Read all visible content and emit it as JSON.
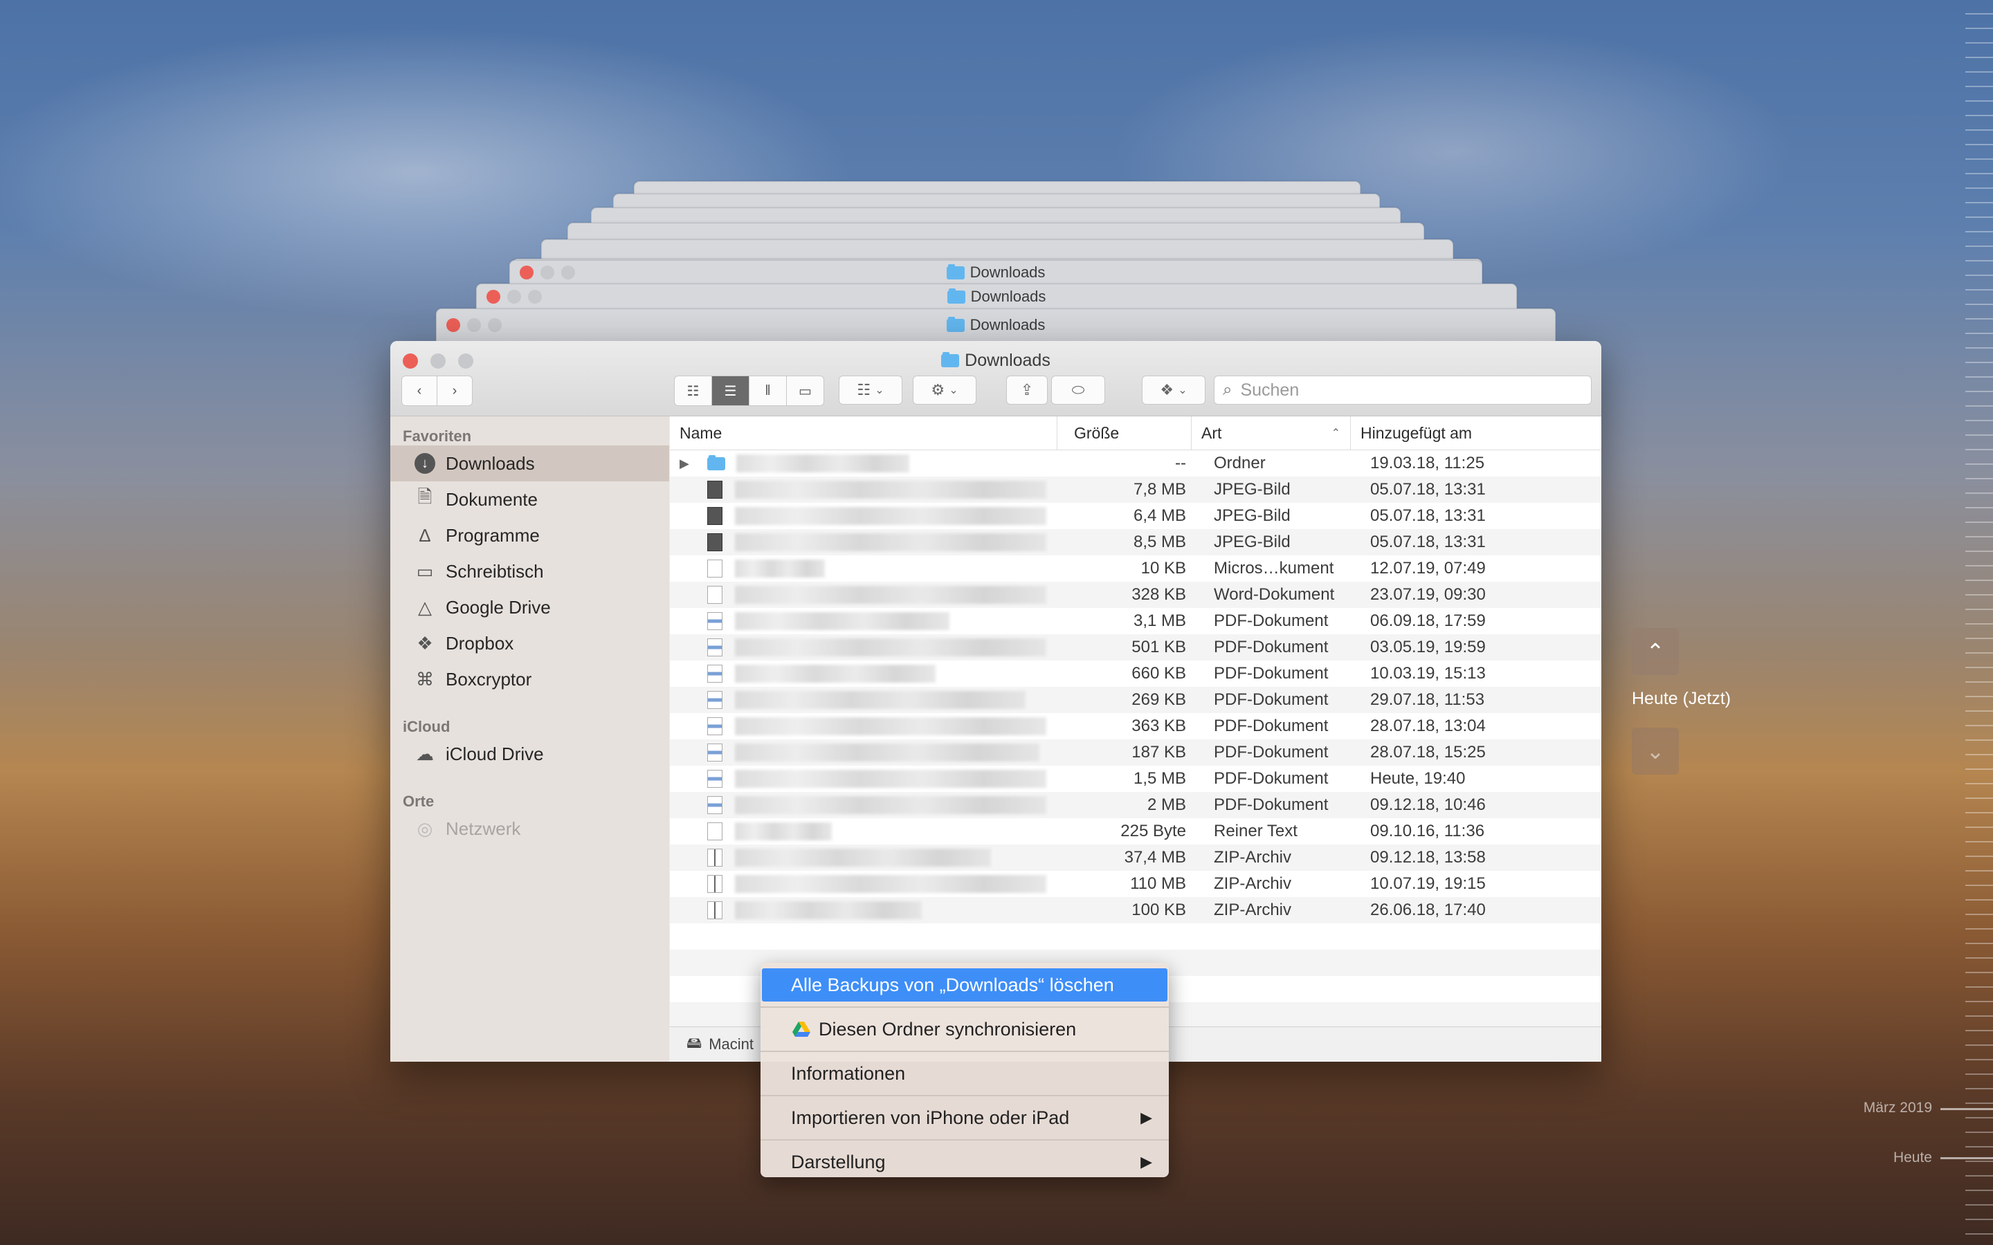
{
  "stack": {
    "titles": [
      "Downloads",
      "Downloads",
      "Downloads"
    ]
  },
  "window": {
    "title": "Downloads",
    "search_placeholder": "Suchen"
  },
  "sidebar": {
    "sections": [
      {
        "header": "Favoriten"
      },
      {
        "header": "iCloud"
      },
      {
        "header": "Orte"
      }
    ],
    "items": [
      {
        "label": "Downloads",
        "icon": "download-icon"
      },
      {
        "label": "Dokumente",
        "icon": "documents-icon"
      },
      {
        "label": "Programme",
        "icon": "applications-icon"
      },
      {
        "label": "Schreibtisch",
        "icon": "desktop-icon"
      },
      {
        "label": "Google Drive",
        "icon": "google-drive-icon"
      },
      {
        "label": "Dropbox",
        "icon": "dropbox-icon"
      },
      {
        "label": "Boxcryptor",
        "icon": "boxcryptor-icon"
      },
      {
        "label": "iCloud Drive",
        "icon": "icloud-icon"
      },
      {
        "label": "Netzwerk",
        "icon": "network-icon"
      }
    ]
  },
  "columns": {
    "name": "Name",
    "size": "Größe",
    "kind": "Art",
    "date": "Hinzugefügt am"
  },
  "files": [
    {
      "size": "--",
      "kind": "Ordner",
      "date": "19.03.18, 11:25"
    },
    {
      "size": "7,8 MB",
      "kind": "JPEG-Bild",
      "date": "05.07.18, 13:31"
    },
    {
      "size": "6,4 MB",
      "kind": "JPEG-Bild",
      "date": "05.07.18, 13:31"
    },
    {
      "size": "8,5 MB",
      "kind": "JPEG-Bild",
      "date": "05.07.18, 13:31"
    },
    {
      "size": "10 KB",
      "kind": "Micros…kument",
      "date": "12.07.19, 07:49"
    },
    {
      "size": "328 KB",
      "kind": "Word-Dokument",
      "date": "23.07.19, 09:30"
    },
    {
      "size": "3,1 MB",
      "kind": "PDF-Dokument",
      "date": "06.09.18, 17:59"
    },
    {
      "size": "501 KB",
      "kind": "PDF-Dokument",
      "date": "03.05.19, 19:59"
    },
    {
      "size": "660 KB",
      "kind": "PDF-Dokument",
      "date": "10.03.19, 15:13"
    },
    {
      "size": "269 KB",
      "kind": "PDF-Dokument",
      "date": "29.07.18, 11:53"
    },
    {
      "size": "363 KB",
      "kind": "PDF-Dokument",
      "date": "28.07.18, 13:04"
    },
    {
      "size": "187 KB",
      "kind": "PDF-Dokument",
      "date": "28.07.18, 15:25"
    },
    {
      "size": "1,5 MB",
      "kind": "PDF-Dokument",
      "date": "Heute, 19:40"
    },
    {
      "size": "2 MB",
      "kind": "PDF-Dokument",
      "date": "09.12.18, 10:46"
    },
    {
      "size": "225 Byte",
      "kind": "Reiner Text",
      "date": "09.10.16, 11:36"
    },
    {
      "size": "37,4 MB",
      "kind": "ZIP-Archiv",
      "date": "09.12.18, 13:58"
    },
    {
      "size": "110 MB",
      "kind": "ZIP-Archiv",
      "date": "10.07.19, 19:15"
    },
    {
      "size": "100 KB",
      "kind": "ZIP-Archiv",
      "date": "26.06.18, 17:40"
    }
  ],
  "pathbar": {
    "label": "Macint"
  },
  "context_menu": {
    "items": [
      {
        "label": "Alle Backups von „Downloads“ löschen"
      },
      {
        "label": "Diesen Ordner synchronisieren"
      },
      {
        "label": "Informationen"
      },
      {
        "label": "Importieren von iPhone oder iPad",
        "submenu_glyph": "▶"
      },
      {
        "label": "Darstellung",
        "submenu_glyph": "▶"
      }
    ]
  },
  "time_machine": {
    "current_label": "Heute (Jetzt)",
    "timeline_labels": [
      "März 2019",
      "Heute"
    ]
  },
  "colors": {
    "highlight": "#3e8ef7",
    "close_red": "#ec5f57",
    "folder_blue": "#62b6ef"
  }
}
